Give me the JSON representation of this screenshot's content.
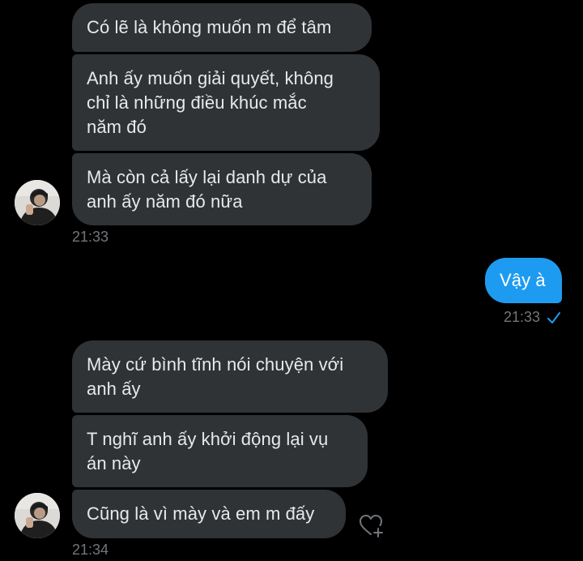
{
  "messages": [
    {
      "text": "Có lẽ là không muốn m để tâm"
    },
    {
      "text": "Anh ấy muốn giải quyết, không\nchỉ là những điều khúc mắc\nnăm đó"
    },
    {
      "text": "Mà còn cả lấy lại danh dự của\nanh ấy năm đó nữa"
    },
    {
      "text": "Vậy à"
    },
    {
      "text": "Mày cứ bình tĩnh nói chuyện với\nanh ấy"
    },
    {
      "text": "T nghĩ anh ấy khởi động lại vụ\nán này"
    },
    {
      "text": "Cũng là vì mày và em m đấy"
    }
  ],
  "timestamps": {
    "group1": "21:33",
    "sent": "21:33",
    "group2": "21:34"
  },
  "icons": {
    "read_receipt": "check-icon",
    "reaction": "heart-plus-icon",
    "avatar": "avatar"
  },
  "colors": {
    "background": "#000000",
    "incoming_bubble": "#2f3336",
    "outgoing_bubble": "#1d9bf0",
    "timestamp": "#71767b"
  }
}
